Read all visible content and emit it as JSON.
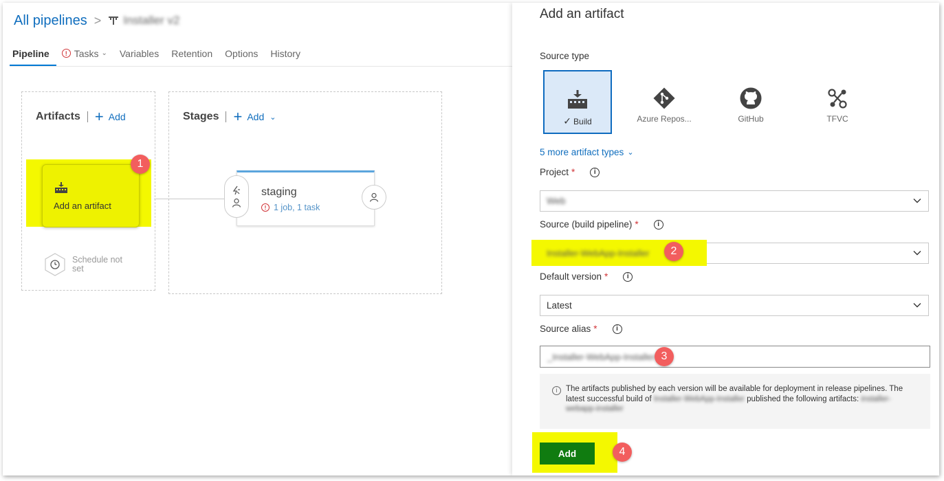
{
  "breadcrumb": {
    "root_label": "All pipelines",
    "separator": ">",
    "pipeline_name": "Installer v2"
  },
  "tabs": [
    {
      "label": "Pipeline",
      "active": true,
      "warning": false
    },
    {
      "label": "Tasks",
      "active": false,
      "warning": true
    },
    {
      "label": "Variables",
      "active": false,
      "warning": false
    },
    {
      "label": "Retention",
      "active": false,
      "warning": false
    },
    {
      "label": "Options",
      "active": false,
      "warning": false
    },
    {
      "label": "History",
      "active": false,
      "warning": false
    }
  ],
  "artifacts_panel": {
    "title": "Artifacts",
    "add_label": "Add",
    "card_label": "Add an artifact",
    "schedule_label": "Schedule not set"
  },
  "stages_panel": {
    "title": "Stages",
    "add_label": "Add",
    "stage": {
      "name": "staging",
      "summary": "1 job, 1 task"
    }
  },
  "annotations": {
    "badge_1": "1",
    "badge_2": "2",
    "badge_3": "3",
    "badge_4": "4",
    "highlight_color": "#f4f800",
    "badge_color": "#f25e5e"
  },
  "add_artifact_panel": {
    "title": "Add an artifact",
    "source_type_label": "Source type",
    "source_types": [
      {
        "label": "Build",
        "icon": "build-icon",
        "selected": true
      },
      {
        "label": "Azure Repos...",
        "icon": "git-icon",
        "selected": false
      },
      {
        "label": "GitHub",
        "icon": "github-icon",
        "selected": false
      },
      {
        "label": "TFVC",
        "icon": "tfvc-icon",
        "selected": false
      }
    ],
    "more_types_label": "5 more artifact types",
    "project": {
      "label": "Project",
      "required_mark": "*",
      "value": "Web"
    },
    "source": {
      "label": "Source (build pipeline)",
      "required_mark": "*",
      "value": "Installer-WebApp-Installer"
    },
    "default_version": {
      "label": "Default version",
      "required_mark": "*",
      "value": "Latest"
    },
    "source_alias": {
      "label": "Source alias",
      "required_mark": "*",
      "value": "_Installer-WebApp-Installer"
    },
    "info_text_1": "The artifacts published by each version will be available for deployment in release pipelines. The latest successful build of",
    "info_blurred_pipeline": "Installer-WebApp-Installer",
    "info_text_2": "published the following artifacts:",
    "info_blurred_artifact": "installer-webapp-installer",
    "add_button_label": "Add",
    "accent_color": "#107c10",
    "link_color": "#106ebe"
  }
}
